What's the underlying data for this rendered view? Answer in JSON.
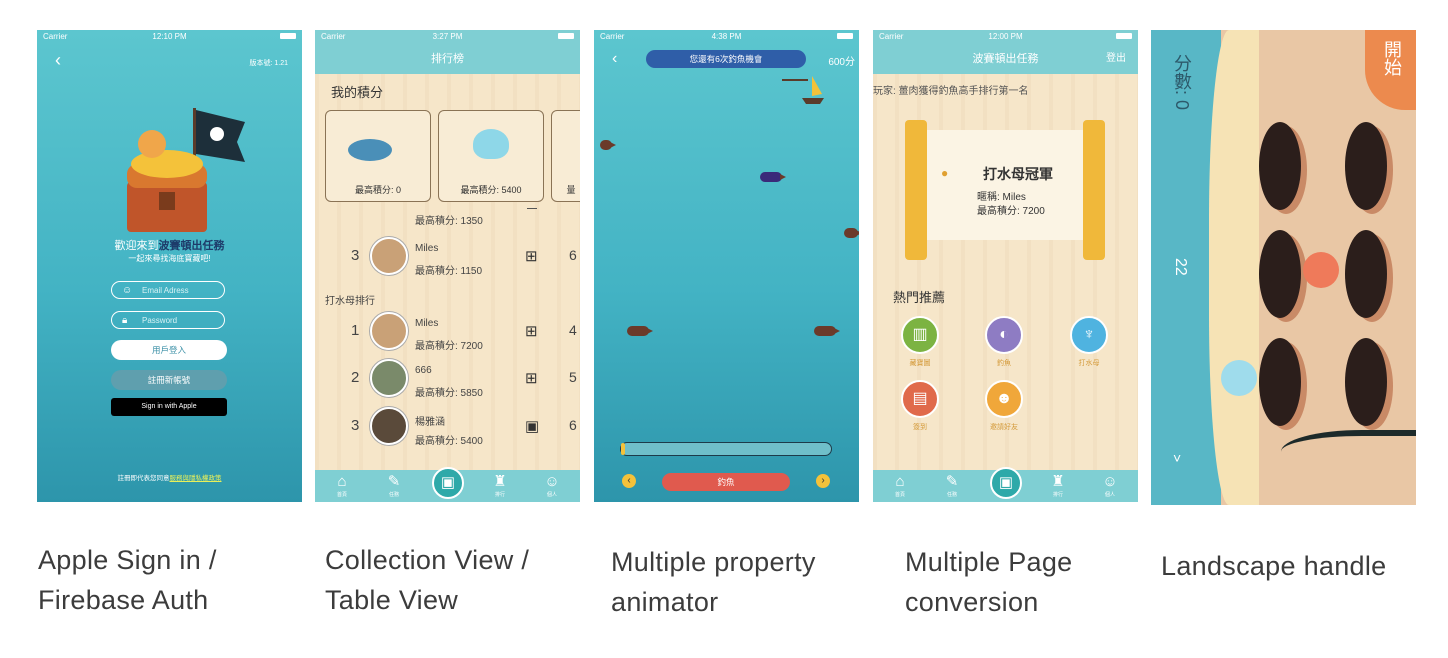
{
  "captions": [
    [
      "Apple Sign in /",
      "Firebase Auth"
    ],
    [
      "Collection View /",
      "Table View"
    ],
    [
      "Multiple property",
      "animator"
    ],
    [
      "Multiple Page",
      "conversion"
    ],
    [
      "Landscape handle"
    ]
  ],
  "screen1": {
    "status_carrier": "Carrier",
    "status_time": "12:10 PM",
    "back_icon": "chevron-left-icon",
    "version": "版本號: 1.21",
    "welcome_prefix": "歡迎來到",
    "welcome_highlight": "波賽頓出任務",
    "subtitle": "一起來尋找海底寶藏吧!",
    "email_placeholder": "Email Adress",
    "password_placeholder": "Password",
    "login_button": "用戶登入",
    "register_button": "註冊新帳號",
    "apple_button": "Sign in with Apple",
    "terms_prefix": "註冊即代表您同意",
    "terms_link": "服務與隱私權政策"
  },
  "screen2": {
    "status_carrier": "Carrier",
    "status_time": "3:27 PM",
    "nav_title": "排行榜",
    "my_score_title": "我的積分",
    "cards": [
      {
        "label": "最高積分: 0"
      },
      {
        "label": "最高積分: 5400"
      },
      {
        "label": "量"
      }
    ],
    "fishing_rows": [
      {
        "rank": "",
        "name": "",
        "score": "最高積分: 1350",
        "count": ""
      },
      {
        "rank": "3",
        "name": "Miles",
        "score": "最高積分: 1150",
        "count": "6"
      }
    ],
    "jelly_section": "打水母排行",
    "jelly_rows": [
      {
        "rank": "1",
        "name": "Miles",
        "score": "最高積分: 7200",
        "count": "4"
      },
      {
        "rank": "2",
        "name": "666",
        "score": "最高積分: 5850",
        "count": "5"
      },
      {
        "rank": "3",
        "name": "楊雅涵",
        "score": "最高積分: 5400",
        "count": "6"
      }
    ],
    "tabs": [
      "首頁",
      "任務",
      "",
      "排行",
      "個人"
    ]
  },
  "screen3": {
    "status_carrier": "Carrier",
    "status_time": "4:38 PM",
    "chances_banner": "您還有6次釣魚機會",
    "score": "600分",
    "fish_button": "釣魚"
  },
  "screen4": {
    "status_carrier": "Carrier",
    "status_time": "12:00 PM",
    "nav_title": "波賽頓出任務",
    "logout": "登出",
    "marquee": "玩家: 薑肉獲得釣魚高手排行第一名",
    "champion_title": "打水母冠軍",
    "champion_nick": "暱稱: Miles",
    "champion_score": "最高積分: 7200",
    "recommend_title": "熱門推薦",
    "recommend": [
      {
        "label": "藏寶圖",
        "color": "#7cb342"
      },
      {
        "label": "釣魚",
        "color": "#8e7cc3"
      },
      {
        "label": "打水母",
        "color": "#4fb3e0"
      },
      {
        "label": "簽到",
        "color": "#e06a4b"
      },
      {
        "label": "邀請好友",
        "color": "#f0a73a"
      }
    ],
    "tabs": [
      "首頁",
      "任務",
      "",
      "排行",
      "個人"
    ]
  },
  "screen5": {
    "score_label": "分數: 0",
    "timer": "22",
    "start_button": "開始",
    "back_icon": "chevron-down-icon"
  }
}
